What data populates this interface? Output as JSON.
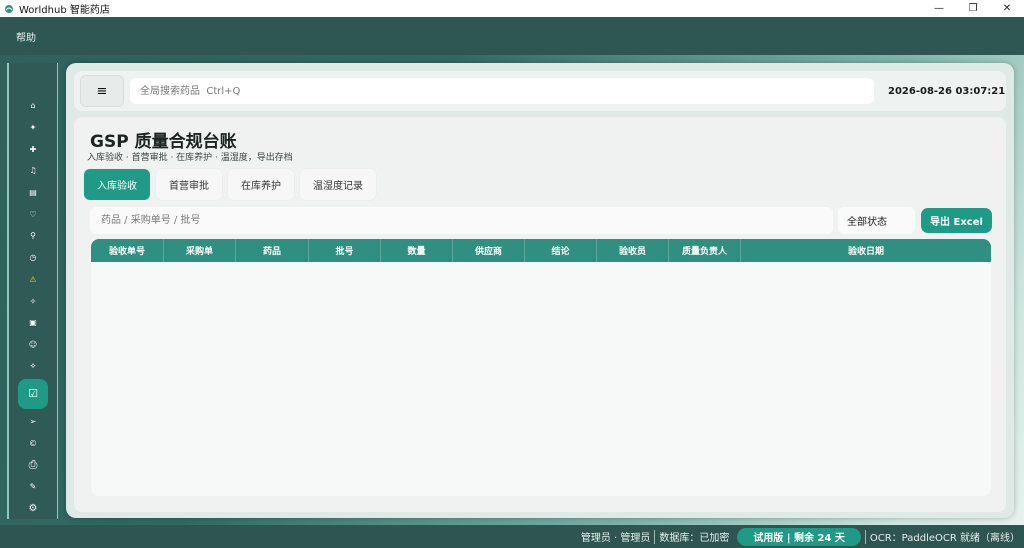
{
  "window": {
    "title": "Worldhub 智能药店",
    "controls": {
      "minimize": "—",
      "maximize": "❐",
      "close": "✕"
    }
  },
  "menubar": {
    "items": [
      {
        "label": "帮助"
      }
    ]
  },
  "sidebar": {
    "items": [
      {
        "icon": "home-icon",
        "glyph": "⌂"
      },
      {
        "icon": "sparkle-icon",
        "glyph": "✦"
      },
      {
        "icon": "plus-icon",
        "glyph": "✚"
      },
      {
        "icon": "bell-icon",
        "glyph": "♫"
      },
      {
        "icon": "document-icon",
        "glyph": "▤"
      },
      {
        "icon": "heart-icon",
        "glyph": "♡"
      },
      {
        "icon": "search-icon",
        "glyph": "⚲"
      },
      {
        "icon": "clock-icon",
        "glyph": "◷"
      },
      {
        "icon": "warning-icon",
        "glyph": "⚠"
      },
      {
        "icon": "medicine-icon",
        "glyph": "✧"
      },
      {
        "icon": "grid-icon",
        "glyph": "▣"
      },
      {
        "icon": "user-icon",
        "glyph": "☺"
      },
      {
        "icon": "location-icon",
        "glyph": "⟡"
      },
      {
        "icon": "compliance-check-icon",
        "glyph": "☑"
      },
      {
        "icon": "send-icon",
        "glyph": "➢"
      },
      {
        "icon": "copyright-icon",
        "glyph": "©"
      },
      {
        "icon": "printer-icon",
        "glyph": "⎙"
      },
      {
        "icon": "edit-icon",
        "glyph": "✎"
      },
      {
        "icon": "settings-icon",
        "glyph": "⚙"
      }
    ]
  },
  "topbar": {
    "menu_glyph": "≡",
    "search_placeholder": "全局搜索药品  Ctrl+Q",
    "datetime": "2026-08-26  03:07:21"
  },
  "page": {
    "title": "GSP 质量合规台账",
    "subtitle": "入库验收 · 首营审批 · 在库养护 · 温湿度，导出存档",
    "tabs": [
      {
        "label": "入库验收",
        "active": true
      },
      {
        "label": "首营审批",
        "active": false
      },
      {
        "label": "在库养护",
        "active": false
      },
      {
        "label": "温湿度记录",
        "active": false
      }
    ],
    "filter_placeholder": "药品 / 采购单号 / 批号",
    "status_select": "全部状态",
    "export_label": "导出 Excel"
  },
  "table": {
    "columns": [
      "验收单号",
      "采购单",
      "药品",
      "批号",
      "数量",
      "供应商",
      "结论",
      "验收员",
      "质量负责人",
      "验收日期"
    ],
    "rows": []
  },
  "statusbar": {
    "user": "管理员 · 管理员",
    "database": "数据库：已加密",
    "trial": "试用版 | 剩余 24 天",
    "ocr": "OCR：PaddleOCR 就绪（离线）"
  },
  "colors": {
    "accent": "#1f9a86",
    "header": "#2f8f80",
    "dark_bg": "#2e5550",
    "warning": "#ffd400"
  }
}
